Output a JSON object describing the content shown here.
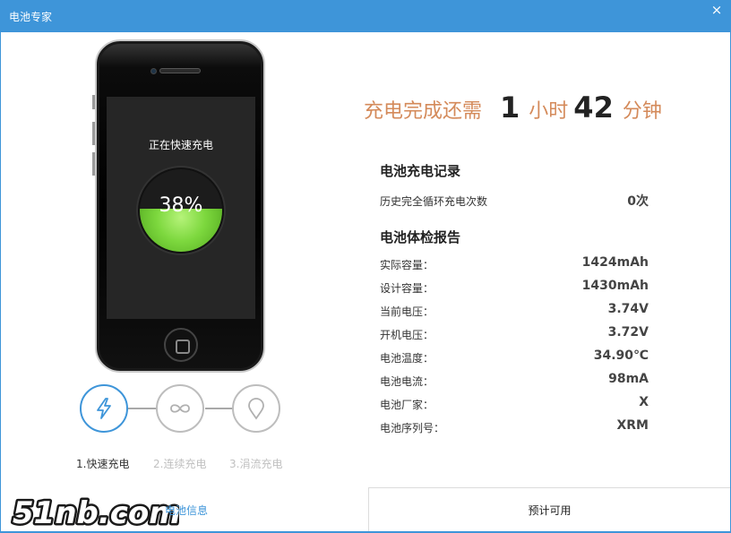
{
  "window": {
    "title": "电池专家",
    "close_glyph": "×"
  },
  "phone": {
    "status_text": "正在快速充电",
    "battery_percent_label": "38%",
    "battery_level": 0.38
  },
  "steps": [
    {
      "label": "1.快速充电",
      "icon": "lightning-icon",
      "active": true
    },
    {
      "label": "2.连续充电",
      "icon": "infinity-icon",
      "active": false
    },
    {
      "label": "3.涓流充电",
      "icon": "drop-icon",
      "active": false
    }
  ],
  "battery_info_link": "电池信息",
  "watermark_text": "51nb.com",
  "time_remaining": {
    "prefix": "充电完成还需",
    "hours": "1",
    "hours_unit": "小时",
    "minutes": "42",
    "minutes_unit": "分钟"
  },
  "charge_record": {
    "title": "电池充电记录",
    "rows": [
      {
        "label": "历史完全循环充电次数",
        "value": "0次"
      }
    ]
  },
  "health_report": {
    "title": "电池体检报告",
    "rows": [
      {
        "label": "实际容量：",
        "value": "1424mAh"
      },
      {
        "label": "设计容量：",
        "value": "1430mAh"
      },
      {
        "label": "当前电压：",
        "value": "3.74V"
      },
      {
        "label": "开机电压：",
        "value": "3.72V"
      },
      {
        "label": "电池温度：",
        "value": "34.90℃"
      },
      {
        "label": "电池电流：",
        "value": "98mA"
      },
      {
        "label": "电池厂家：",
        "value": "X"
      },
      {
        "label": "电池序列号：",
        "value": "XRM"
      }
    ]
  },
  "bottom_button": "预计可用",
  "colors": {
    "accent": "#3e95d9",
    "highlight": "#d48a5a",
    "battery_green": "#7dd83e"
  }
}
